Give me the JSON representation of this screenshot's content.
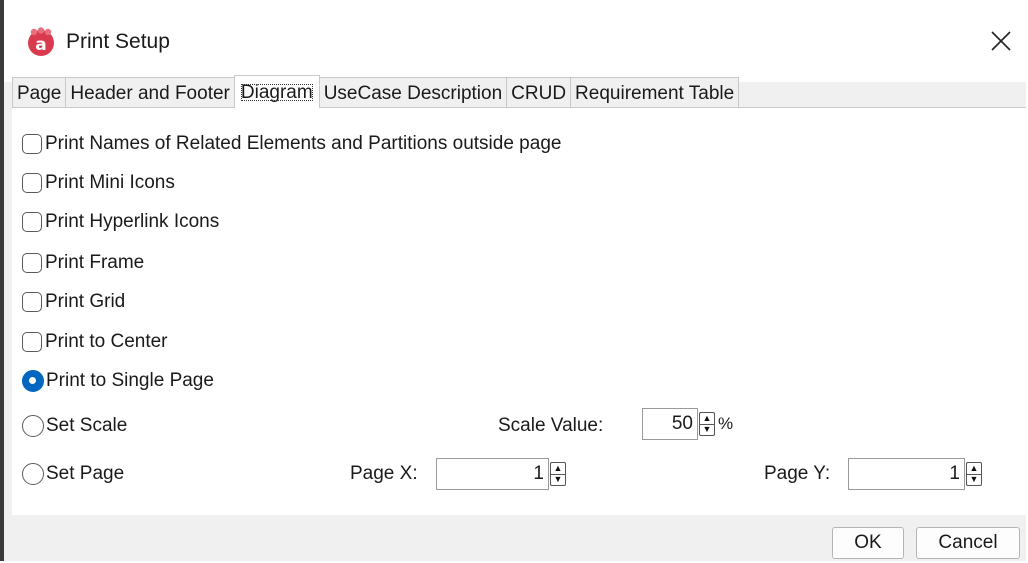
{
  "window": {
    "title": "Print Setup",
    "app_icon": "astah-logo-icon",
    "close_icon": "close-icon"
  },
  "tabs": [
    {
      "label": "Page",
      "active": false
    },
    {
      "label": "Header and Footer",
      "active": false
    },
    {
      "label": "Diagram",
      "active": true
    },
    {
      "label": "UseCase Description",
      "active": false
    },
    {
      "label": "CRUD",
      "active": false
    },
    {
      "label": "Requirement Table",
      "active": false
    }
  ],
  "options": {
    "print_names": {
      "label": "Print Names of Related Elements and Partitions outside page",
      "checked": false
    },
    "print_mini_icons": {
      "label": "Print Mini Icons",
      "checked": false
    },
    "print_hyperlink_icons": {
      "label": "Print Hyperlink Icons",
      "checked": false
    },
    "print_frame": {
      "label": "Print Frame",
      "checked": false
    },
    "print_grid": {
      "label": "Print Grid",
      "checked": false
    },
    "print_to_center": {
      "label": "Print to Center",
      "checked": false
    }
  },
  "layout_mode": {
    "selected": "single_page",
    "single_page_label": "Print to Single Page",
    "set_scale_label": "Set Scale",
    "set_page_label": "Set Page"
  },
  "scale": {
    "label": "Scale Value:",
    "value": "50",
    "unit": "%"
  },
  "page_x": {
    "label": "Page X:",
    "value": "1"
  },
  "page_y": {
    "label": "Page Y:",
    "value": "1"
  },
  "buttons": {
    "ok": "OK",
    "cancel": "Cancel"
  },
  "colors": {
    "accent": "#0067c0",
    "logo": "#d93a4e"
  }
}
